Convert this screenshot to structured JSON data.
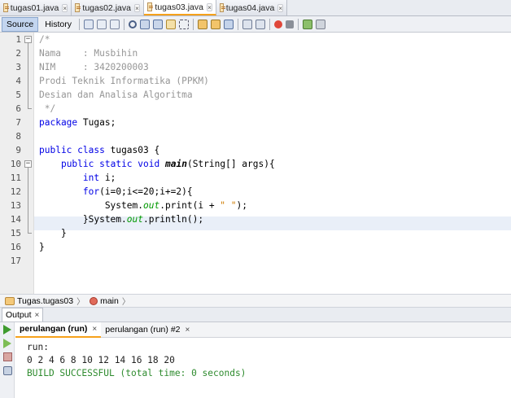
{
  "file_tabs": [
    {
      "label": "tugas01.java",
      "active": false
    },
    {
      "label": "tugas02.java",
      "active": false
    },
    {
      "label": "tugas03.java",
      "active": true
    },
    {
      "label": "tugas04.java",
      "active": false
    }
  ],
  "tab_close_glyph": "×",
  "toolbar": {
    "source_label": "Source",
    "history_label": "History"
  },
  "line_numbers": [
    "1",
    "2",
    "3",
    "4",
    "5",
    "6",
    "7",
    "8",
    "9",
    "10",
    "11",
    "12",
    "13",
    "14",
    "15",
    "16",
    "17"
  ],
  "fold_glyph": "−",
  "code_lines": [
    "/*",
    "Nama    : Musbihin",
    "NIM     : 3420200003",
    "Prodi Teknik Informatika (PPKM)",
    "Desian dan Analisa Algoritma",
    " */",
    "package Tugas;",
    "",
    "public class tugas03 {",
    "    public static void main(String[] args){",
    "        int i;",
    "        for(i=0;i<=20;i+=2){",
    "            System.out.print(i + \" \");",
    "        }System.out.println();",
    "    }",
    "}",
    ""
  ],
  "highlighted_line": "14",
  "breadcrumb": {
    "class_path": "Tugas.tugas03",
    "method": "main",
    "separator": "〉"
  },
  "output": {
    "panel_title": "Output",
    "close_glyph": "×",
    "run_tabs": [
      {
        "label": "perulangan (run)",
        "active": true
      },
      {
        "label": "perulangan (run) #2",
        "active": false
      }
    ],
    "lines": [
      "run:",
      "0 2 4 6 8 10 12 14 16 18 20",
      "BUILD SUCCESSFUL (total time: 0 seconds)"
    ]
  },
  "colors": {
    "keyword": "#0000e6",
    "comment": "#969696",
    "field": "#009900",
    "string": "#ce7b00",
    "success": "#2e8b2e",
    "active_tab_accent": "#f6a11b"
  }
}
